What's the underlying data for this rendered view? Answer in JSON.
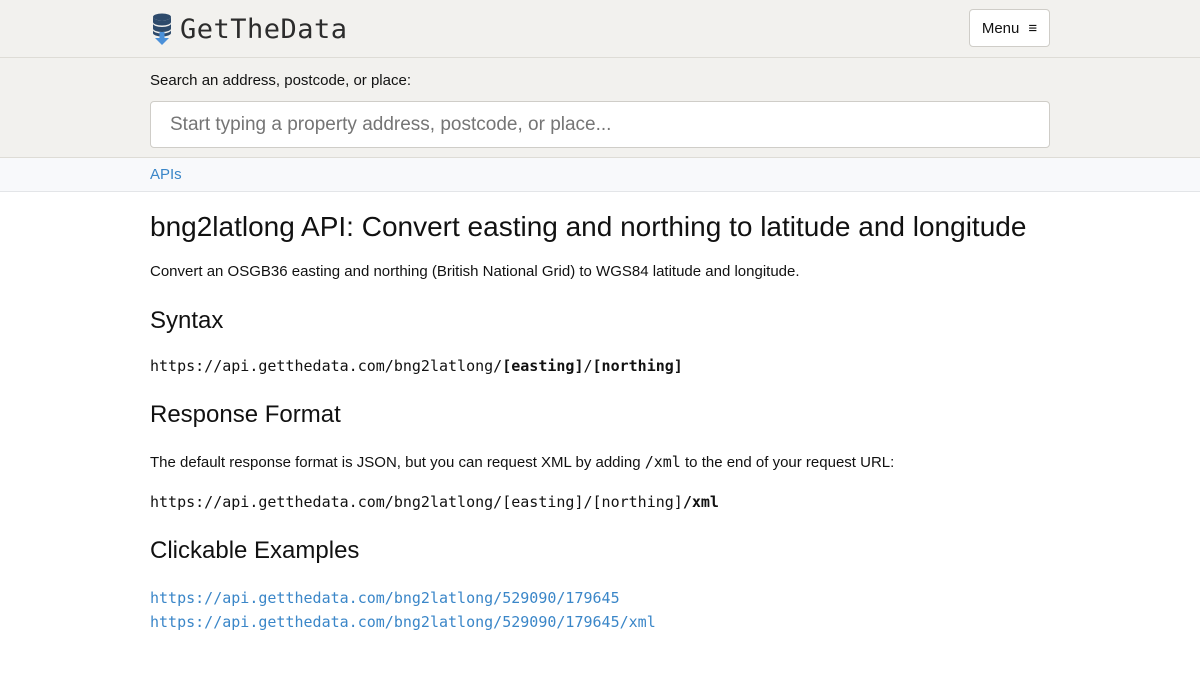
{
  "header": {
    "logo_text": "GetTheData",
    "logo_icon": "database-download-icon",
    "menu_label": "Menu",
    "menu_icon": "≡"
  },
  "search": {
    "label": "Search an address, postcode, or place:",
    "placeholder": "Start typing a property address, postcode, or place...",
    "value": ""
  },
  "breadcrumb": {
    "items": [
      "APIs"
    ]
  },
  "main": {
    "title": "bng2latlong API: Convert easting and northing to latitude and longitude",
    "intro": "Convert an OSGB36 easting and northing (British National Grid) to WGS84 latitude and longitude.",
    "syntax": {
      "heading": "Syntax",
      "base": "https://api.getthedata.com/bng2latlong/",
      "param_easting": "[easting]",
      "sep": "/",
      "param_northing": "[northing]"
    },
    "response_format": {
      "heading": "Response Format",
      "text_before": "The default response format is JSON, but you can request XML by adding ",
      "code": "/xml",
      "text_after": " to the end of your request URL:",
      "url_base": "https://api.getthedata.com/bng2latlong/[easting]/[northing]",
      "url_suffix": "/xml"
    },
    "examples": {
      "heading": "Clickable Examples",
      "links": [
        "https://api.getthedata.com/bng2latlong/529090/179645",
        "https://api.getthedata.com/bng2latlong/529090/179645/xml"
      ]
    }
  },
  "colors": {
    "header_bg": "#f2f1ee",
    "link": "#3a86c8",
    "logo_icon_body": "#2d4a6b",
    "logo_icon_arrow": "#4a90d9"
  }
}
